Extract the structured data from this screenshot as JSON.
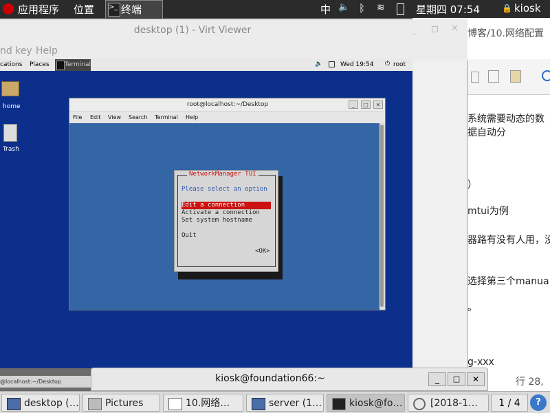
{
  "host_topbar": {
    "apps": "应用程序",
    "places": "位置",
    "terminal": "终端",
    "ime": "中",
    "datetime": "星期四 07:54",
    "user": "kiosk"
  },
  "doc": {
    "title_fragment": "博客/10.网络配置",
    "lines": [
      "系统需要动态的数据自动分",
      "）",
      "mtui为例",
      "器路有没有人用，没",
      "选择第三个manua",
      "。",
      "g-xxx"
    ],
    "status": "行 28,"
  },
  "virt_viewer": {
    "title": "desktop (1) - Virt Viewer",
    "menu": [
      "nd key",
      "Help"
    ]
  },
  "guest": {
    "topbar": {
      "applications": "cations",
      "places": "Places",
      "terminal": "Terminal",
      "time": "Wed 19:54",
      "user": "root"
    },
    "desktop_icons": [
      {
        "label": "home"
      },
      {
        "label": "Trash"
      }
    ],
    "bottom_task": "@localhost:~/Desktop",
    "terminal": {
      "title": "root@localhost:~/Desktop",
      "menu": [
        "File",
        "Edit",
        "View",
        "Search",
        "Terminal",
        "Help"
      ]
    },
    "tui": {
      "title": "NetworkManager TUI",
      "prompt": "Please select an option",
      "options": [
        "Edit a connection",
        "Activate a connection",
        "Set system hostname"
      ],
      "quit": "Quit",
      "ok": "<OK>"
    }
  },
  "kiosk_terminal": {
    "title": "kiosk@foundation66:~"
  },
  "taskbar": {
    "items": [
      {
        "label": "desktop (…"
      },
      {
        "label": "Pictures"
      },
      {
        "label": "10.网络…"
      },
      {
        "label": "server (1…"
      },
      {
        "label": "kiosk@fo…"
      },
      {
        "label": "[2018-1…"
      }
    ],
    "workspace": "1 / 4"
  },
  "colors": {
    "selection": "#cc1111",
    "guest_bg": "#0d2f8c",
    "term_bg": "#3465a4"
  }
}
